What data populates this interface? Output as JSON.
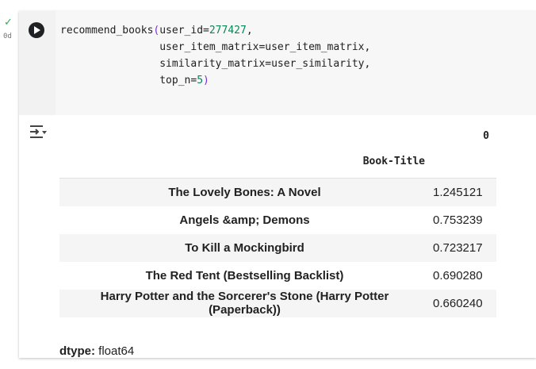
{
  "status": {
    "check_symbol": "✓",
    "elapsed": "0d"
  },
  "code": {
    "lines": [
      [
        {
          "t": "recommend_books",
          "c": ""
        },
        {
          "t": "(",
          "c": "tok-paren"
        },
        {
          "t": "user_id=",
          "c": ""
        },
        {
          "t": "277427",
          "c": "tok-num"
        },
        {
          "t": ",",
          "c": ""
        }
      ],
      [
        {
          "t": "                user_item_matrix=user_item_matrix,",
          "c": ""
        }
      ],
      [
        {
          "t": "                similarity_matrix=user_similarity,",
          "c": ""
        }
      ],
      [
        {
          "t": "                top_n=",
          "c": ""
        },
        {
          "t": "5",
          "c": "tok-num"
        },
        {
          "t": ")",
          "c": "tok-paren"
        }
      ]
    ]
  },
  "output": {
    "column_header": "0",
    "index_name": "Book-Title",
    "rows": [
      {
        "title": "The Lovely Bones: A Novel",
        "score": "1.245121"
      },
      {
        "title": "Angels &amp; Demons",
        "score": "0.753239"
      },
      {
        "title": "To Kill a Mockingbird",
        "score": "0.723217"
      },
      {
        "title": "The Red Tent (Bestselling Backlist)",
        "score": "0.690280"
      },
      {
        "title": "Harry Potter and the Sorcerer's Stone (Harry Potter (Paperback))",
        "score": "0.660240"
      }
    ],
    "dtype_label": "dtype:",
    "dtype_value": "float64"
  },
  "icons": {
    "run": "play-icon",
    "output_actions": "output-actions-icon"
  },
  "colors": {
    "success": "#34a853",
    "number": "#098658",
    "paren": "#7b30d0"
  }
}
